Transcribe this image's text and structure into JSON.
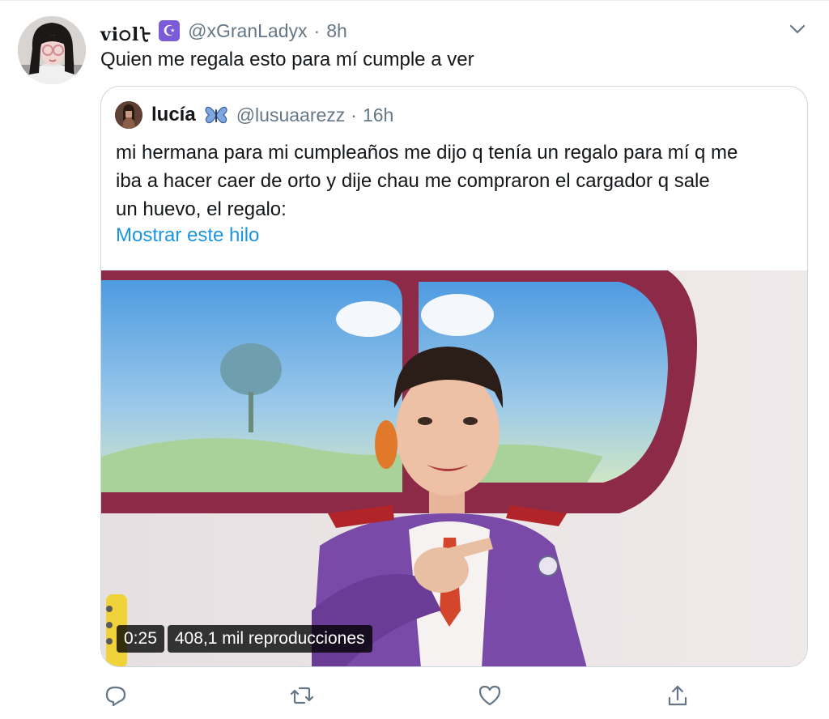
{
  "tweet": {
    "display_name": "vi੦lᡶ",
    "badge_glyph": "☪",
    "handle": "@xGranLadyx",
    "separator": "·",
    "time": "8h",
    "text": "Quien me regala esto para mí cumple a ver",
    "more_icon": "chevron-down-icon"
  },
  "quoted_tweet": {
    "name": "lucía",
    "name_emoji": "butterfly-icon",
    "handle": "@lusuaarezz",
    "separator": "·",
    "time": "16h",
    "text_lines": [
      "mi hermana para mi cumpleaños me dijo q tenía un regalo para mí q me",
      "iba a hacer caer de orto y dije chau me compraron el cargador q sale",
      "un huevo, el regalo:"
    ],
    "show_thread": "Mostrar este hilo",
    "video": {
      "duration": "0:25",
      "views": "408,1 mil reproducciones"
    }
  },
  "actions": {
    "reply_icon": "reply-icon",
    "retweet_icon": "retweet-icon",
    "like_icon": "heart-icon",
    "share_icon": "share-icon"
  },
  "colors": {
    "link": "#1b95e0",
    "secondary_text": "#657786",
    "border": "#ccd6dd",
    "badge": "#7b5cd6"
  }
}
